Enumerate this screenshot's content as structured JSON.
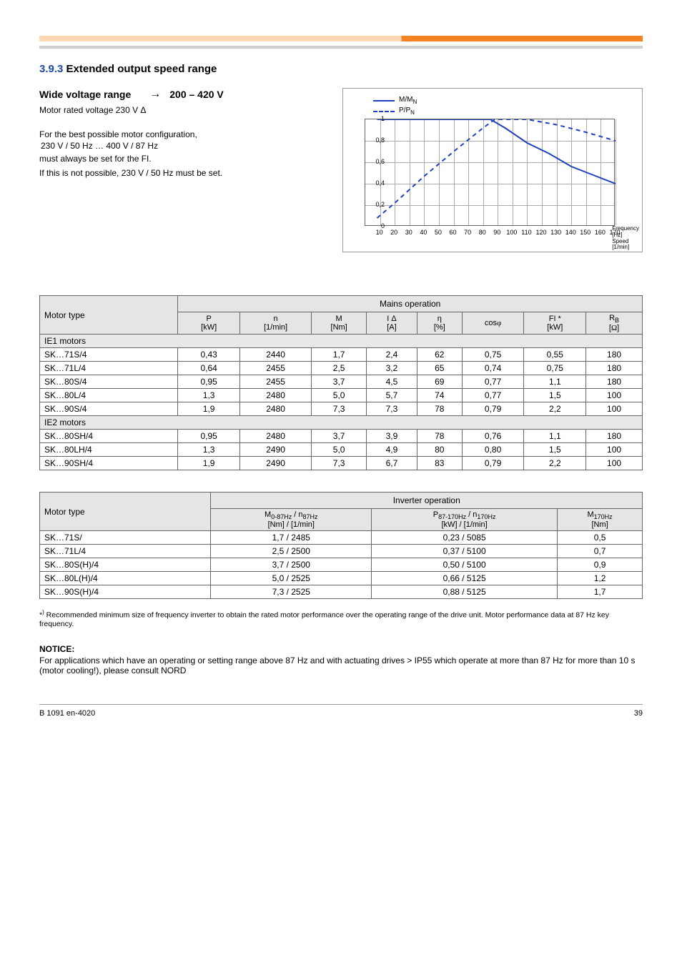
{
  "header": {
    "section_number": "3.9.3",
    "section_title": "Extended output speed range",
    "wide_voltage_label": "Wide voltage range",
    "wide_voltage_range": "200 – 420 V",
    "motor_voltage_desc": "Motor rated voltage 230 V Δ",
    "config_label": "For the best possible motor configuration,",
    "config_val": "230 V / 50 Hz … 400 V / 87 Hz",
    "config_note": "must always be set for the FI.",
    "supply_line": "If this is not possible, 230 V / 50 Hz must be set."
  },
  "chart_data": {
    "type": "line",
    "legend": [
      {
        "style": "solid",
        "label_html": "M/M<sub>N</sub>"
      },
      {
        "style": "dashed",
        "label_html": "P/P<sub>N</sub>"
      }
    ],
    "x_label_lines": [
      "Frequency",
      "[Hz]",
      "Speed",
      "[1/min]"
    ],
    "y_ticks": [
      "1",
      "0,8",
      "0,6",
      "0,4",
      "0,2",
      "0"
    ],
    "x_ticks_hz": [
      "10",
      "20",
      "30",
      "40",
      "50",
      "60",
      "70",
      "80",
      "90",
      "100",
      "110",
      "120",
      "130",
      "140",
      "150",
      "160",
      "170"
    ],
    "xlim": [
      0,
      170
    ],
    "ylim": [
      0,
      1
    ],
    "series": [
      {
        "name": "M/M_N",
        "style": "solid",
        "points": [
          [
            8,
            1.0
          ],
          [
            85,
            1.0
          ],
          [
            95,
            0.92
          ],
          [
            110,
            0.78
          ],
          [
            125,
            0.68
          ],
          [
            140,
            0.56
          ],
          [
            155,
            0.48
          ],
          [
            170,
            0.4
          ]
        ]
      },
      {
        "name": "P/P_N",
        "style": "dashed",
        "points": [
          [
            8,
            0.08
          ],
          [
            20,
            0.22
          ],
          [
            40,
            0.47
          ],
          [
            60,
            0.7
          ],
          [
            80,
            0.92
          ],
          [
            88,
            1.0
          ],
          [
            110,
            1.0
          ],
          [
            130,
            0.95
          ],
          [
            150,
            0.88
          ],
          [
            170,
            0.8
          ]
        ]
      }
    ]
  },
  "t1": {
    "head": {
      "motor_type": "Motor type",
      "mains_op": "Mains operation",
      "cols": [
        {
          "h": "P",
          "u": "[kW]"
        },
        {
          "h": "n",
          "u": "[1/min]"
        },
        {
          "h": "M",
          "u": "[Nm]"
        },
        {
          "h": "I Δ",
          "u": "[A]"
        },
        {
          "h": "η",
          "u": "[%]"
        },
        {
          "h": "cos<span class='sym'>φ</span>",
          "u": ""
        },
        {
          "h": "FI *",
          "u": "[kW]"
        },
        {
          "h": "R<sub>B</sub>",
          "u": "[<span class='sym'>Ω</span>]"
        }
      ]
    },
    "rows": [
      {
        "type": "gray",
        "label": "IE1 motors"
      },
      {
        "type": "data",
        "cells": [
          "SK…71S/4",
          "0,43",
          "2440",
          "1,7",
          "2,4",
          "62",
          "0,75",
          "0,55",
          "180"
        ]
      },
      {
        "type": "data",
        "cells": [
          "SK…71L/4",
          "0,64",
          "2455",
          "2,5",
          "3,2",
          "65",
          "0,74",
          "0,75",
          "180"
        ]
      },
      {
        "type": "data",
        "cells": [
          "SK…80S/4",
          "0,95",
          "2455",
          "3,7",
          "4,5",
          "69",
          "0,77",
          "1,1",
          "180"
        ]
      },
      {
        "type": "data",
        "cells": [
          "SK…80L/4",
          "1,3",
          "2480",
          "5,0",
          "5,7",
          "74",
          "0,77",
          "1,5",
          "100"
        ]
      },
      {
        "type": "data",
        "cells": [
          "SK…90S/4",
          "1,9",
          "2480",
          "7,3",
          "7,3",
          "78",
          "0,79",
          "2,2",
          "100"
        ]
      },
      {
        "type": "gray",
        "label": "IE2 motors"
      },
      {
        "type": "data",
        "cells": [
          "SK…80SH/4",
          "0,95",
          "2480",
          "3,7",
          "3,9",
          "78",
          "0,76",
          "1,1",
          "180"
        ]
      },
      {
        "type": "data",
        "cells": [
          "SK…80LH/4",
          "1,3",
          "2490",
          "5,0",
          "4,9",
          "80",
          "0,80",
          "1,5",
          "100"
        ]
      },
      {
        "type": "data",
        "cells": [
          "SK…90SH/4",
          "1,9",
          "2490",
          "7,3",
          "6,7",
          "83",
          "0,79",
          "2,2",
          "100"
        ]
      }
    ]
  },
  "t2": {
    "head": {
      "motor_type": "Motor type",
      "inv_op": "Inverter operation",
      "cols": [
        {
          "h": "M<sub>0-87Hz</sub> / n<sub>87Hz</sub>",
          "u": "[Nm] / [1/min]"
        },
        {
          "h": "P<sub>87-170Hz</sub> / n<sub>170Hz</sub>",
          "u": "[kW] / [1/min]"
        },
        {
          "h": "M<sub>170Hz</sub>",
          "u": "[Nm]"
        }
      ]
    },
    "rows": [
      [
        "SK…71S/",
        "1,7 / 2485",
        "0,23 / 5085",
        "0,5"
      ],
      [
        "SK…71L/4",
        "2,5 / 2500",
        "0,37 / 5100",
        "0,7"
      ],
      [
        "SK…80S(H)/4",
        "3,7 / 2500",
        "0,50 / 5100",
        "0,9"
      ],
      [
        "SK…80L(H)/4",
        "5,0 / 2525",
        "0,66 / 5125",
        "1,2"
      ],
      [
        "SK…90S(H)/4",
        "7,3 / 2525",
        "0,88 / 5125",
        "1,7"
      ]
    ]
  },
  "footnote": "*<sup>)</sup> Recommended minimum size of frequency inverter to obtain the rated motor performance over the operating range of the drive unit. Motor performance data at 87 Hz key frequency.",
  "notice_title": "NOTICE:",
  "notice_body": "For applications which have an operating or setting range above 87 Hz and with actuating drives > IP55 which operate at more than 87 Hz for more than 10 s (motor cooling!), please consult NORD",
  "footer_left": "B 1091 en-4020",
  "footer_right": "39"
}
